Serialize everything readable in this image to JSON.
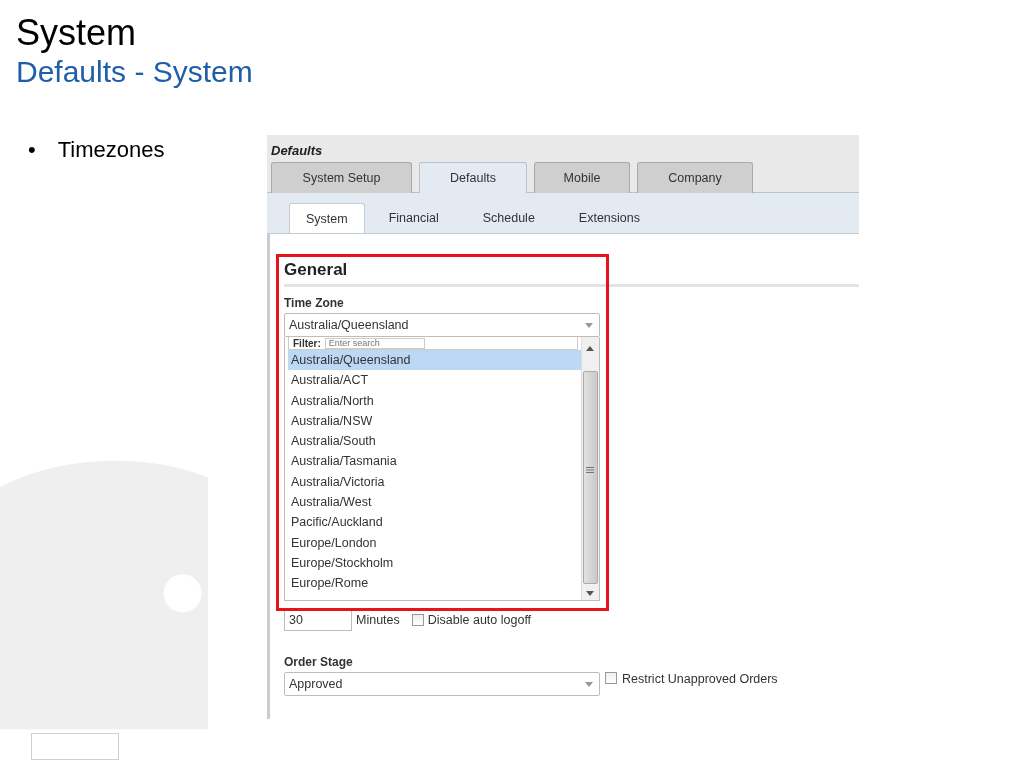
{
  "slide": {
    "title": "System",
    "subtitle": "Defaults - System",
    "bullets": [
      {
        "marker": "•",
        "text": "Timezones"
      }
    ]
  },
  "panel": {
    "title": "Defaults",
    "tabs": [
      {
        "label": "System Setup",
        "selected": false
      },
      {
        "label": "Defaults",
        "selected": true
      },
      {
        "label": "Mobile",
        "selected": false
      },
      {
        "label": "Company",
        "selected": false
      }
    ],
    "subtabs": [
      {
        "label": "System",
        "selected": true
      },
      {
        "label": "Financial",
        "selected": false
      },
      {
        "label": "Schedule",
        "selected": false
      },
      {
        "label": "Extensions",
        "selected": false
      }
    ],
    "section": "General",
    "time_zone": {
      "label": "Time Zone",
      "value": "Australia/Queensland",
      "filter_label": "Filter:",
      "filter_placeholder": "Enter search",
      "options": [
        {
          "label": "Australia/Queensland",
          "selected": true
        },
        {
          "label": "Australia/ACT",
          "selected": false
        },
        {
          "label": "Australia/North",
          "selected": false
        },
        {
          "label": "Australia/NSW",
          "selected": false
        },
        {
          "label": "Australia/South",
          "selected": false
        },
        {
          "label": "Australia/Tasmania",
          "selected": false
        },
        {
          "label": "Australia/Victoria",
          "selected": false
        },
        {
          "label": "Australia/West",
          "selected": false
        },
        {
          "label": "Pacific/Auckland",
          "selected": false
        },
        {
          "label": "Europe/London",
          "selected": false
        },
        {
          "label": "Europe/Stockholm",
          "selected": false
        },
        {
          "label": "Europe/Rome",
          "selected": false
        }
      ]
    },
    "timeout": {
      "value": "30",
      "unit": "Minutes",
      "checkbox": {
        "label": "Disable auto logoff",
        "checked": false
      }
    },
    "order_stage": {
      "label": "Order Stage",
      "value": "Approved",
      "checkbox": {
        "label": "Restrict Unapproved Orders",
        "checked": false
      }
    }
  }
}
